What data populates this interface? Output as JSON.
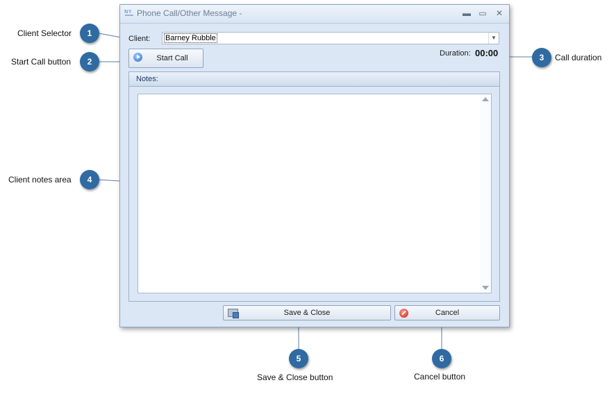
{
  "window": {
    "title": "Phone Call/Other Message -",
    "minimize_glyph": "▬",
    "maximize_glyph": "▭",
    "close_glyph": "✕"
  },
  "client": {
    "label": "Client:",
    "selected": "Barney Rubble"
  },
  "start_call": {
    "label": "Start Call"
  },
  "duration": {
    "label": "Duration:",
    "value": "00:00"
  },
  "notes": {
    "label": "Notes:",
    "content": ""
  },
  "buttons": {
    "save_close": "Save & Close",
    "cancel": "Cancel"
  },
  "callouts": [
    {
      "number": "1",
      "text": "Client Selector"
    },
    {
      "number": "2",
      "text": "Start Call button"
    },
    {
      "number": "3",
      "text": "Call duration"
    },
    {
      "number": "4",
      "text": "Client notes area"
    },
    {
      "number": "5",
      "text": "Save & Close button"
    },
    {
      "number": "6",
      "text": "Cancel button"
    }
  ],
  "colors": {
    "badge": "#2f6aa2",
    "window_bg": "#dbe7f5",
    "title_text": "#6d7f96"
  }
}
